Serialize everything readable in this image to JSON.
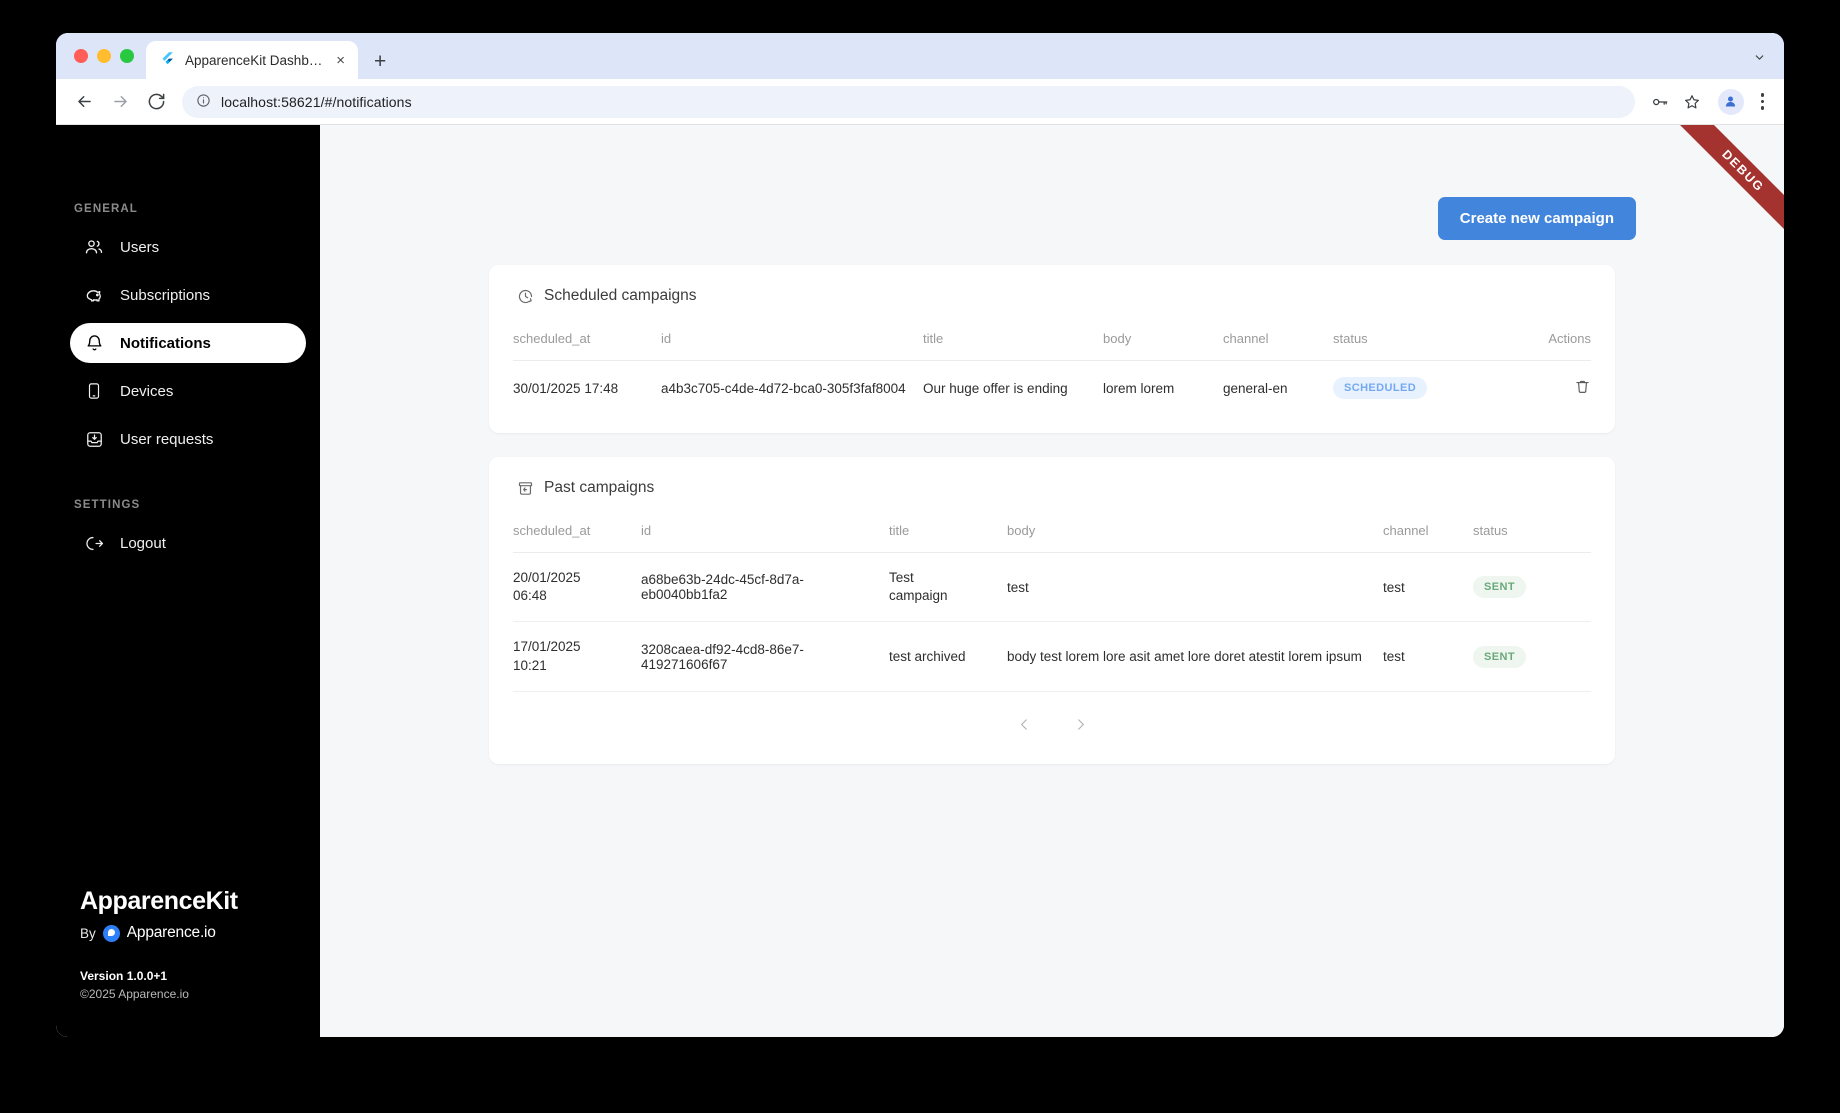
{
  "browser": {
    "tab_title": "ApparenceKit Dashboard",
    "tab_close_label": "×",
    "new_tab_label": "+",
    "url": "localhost:58621/#/notifications",
    "icons": {
      "back": "back-arrow-icon",
      "forward": "forward-arrow-icon",
      "reload": "reload-icon",
      "site_info": "info-circle-icon",
      "password": "key-icon",
      "bookmark": "star-icon",
      "profile": "profile-avatar-icon",
      "menu": "kebab-menu-icon",
      "tab_list": "chevron-down-icon"
    }
  },
  "debug_ribbon": {
    "label": "DEBUG",
    "color": "#a4332f"
  },
  "sidebar": {
    "sections": [
      {
        "label": "GENERAL",
        "items": [
          {
            "label": "Users",
            "icon": "users-icon",
            "active": false
          },
          {
            "label": "Subscriptions",
            "icon": "piggy-bank-icon",
            "active": false
          },
          {
            "label": "Notifications",
            "icon": "bell-icon",
            "active": true
          },
          {
            "label": "Devices",
            "icon": "phone-icon",
            "active": false
          },
          {
            "label": "User requests",
            "icon": "inbox-download-icon",
            "active": false
          }
        ]
      },
      {
        "label": "SETTINGS",
        "items": [
          {
            "label": "Logout",
            "icon": "logout-icon",
            "active": false
          }
        ]
      }
    ],
    "brand": {
      "title": "ApparenceKit",
      "by": "By",
      "company": "Apparence.io",
      "version": "Version 1.0.0+1",
      "copyright": "©2025 Apparence.io"
    }
  },
  "main": {
    "create_button": "Create new campaign",
    "accent_color": "#4285dd",
    "scheduled": {
      "title": "Scheduled campaigns",
      "icon": "clock-arrow-icon",
      "columns": [
        "scheduled_at",
        "id",
        "title",
        "body",
        "channel",
        "status",
        "Actions"
      ],
      "rows": [
        {
          "scheduled_at": "30/01/2025 17:48",
          "id": "a4b3c705-c4de-4d72-bca0-305f3faf8004",
          "title": "Our huge offer is ending",
          "body": "lorem lorem",
          "channel": "general-en",
          "status": "SCHEDULED",
          "action_icon": "trash-icon"
        }
      ]
    },
    "past": {
      "title": "Past campaigns",
      "icon": "archive-restore-icon",
      "columns": [
        "scheduled_at",
        "id",
        "title",
        "body",
        "channel",
        "status"
      ],
      "rows": [
        {
          "scheduled_at": "20/01/2025\n06:48",
          "id": "a68be63b-24dc-45cf-8d7a-eb0040bb1fa2",
          "title": "Test\ncampaign",
          "body": "test",
          "channel": "test",
          "status": "SENT"
        },
        {
          "scheduled_at": "17/01/2025\n10:21",
          "id": "3208caea-df92-4cd8-86e7-419271606f67",
          "title": "test archived",
          "body": "body test lorem lore asit amet lore doret atestit lorem ipsum",
          "channel": "test",
          "status": "SENT"
        }
      ],
      "pagination": {
        "prev_icon": "chevron-left-icon",
        "next_icon": "chevron-right-icon"
      }
    },
    "badge_colors": {
      "scheduled_bg": "#e8f1fe",
      "scheduled_fg": "#74a9f0",
      "sent_bg": "#eef6ef",
      "sent_fg": "#6aa97a"
    }
  }
}
